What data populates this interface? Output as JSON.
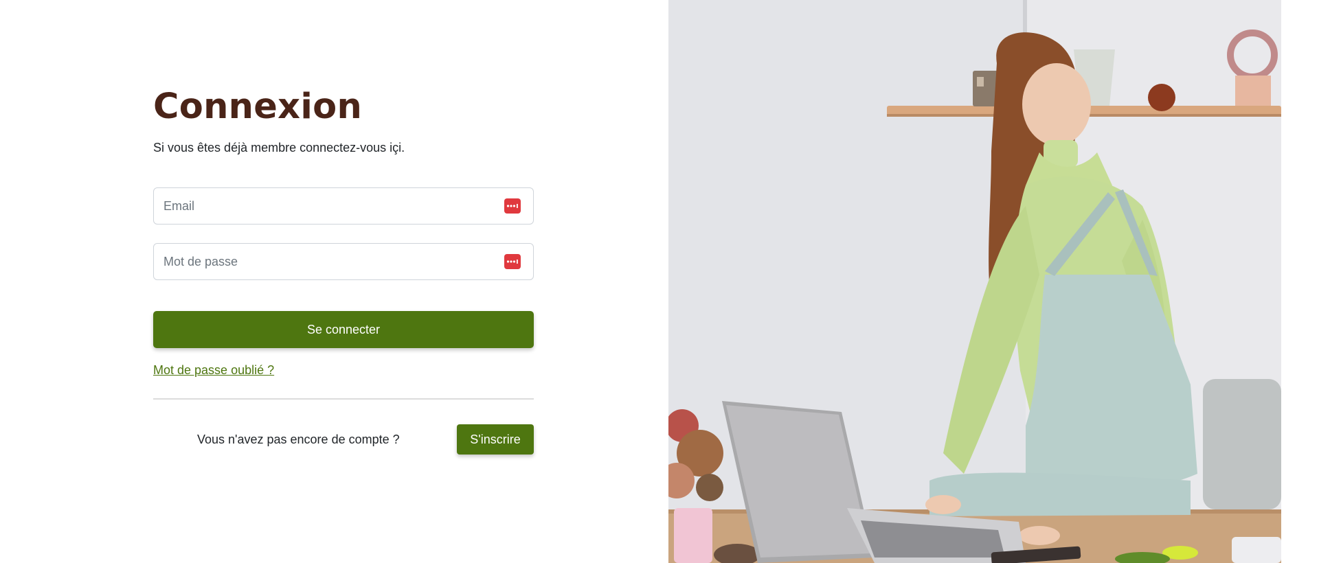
{
  "login": {
    "title": "Connexion",
    "subtitle": "Si vous êtes déjà membre connectez-vous içi.",
    "email_placeholder": "Email",
    "password_placeholder": "Mot de passe",
    "submit_label": "Se connecter",
    "forgot_label": "Mot de passe oublié ?"
  },
  "signup": {
    "prompt": "Vous n'avez pas encore de compte ?",
    "button_label": "S'inscrire"
  },
  "icons": {
    "field_icon": "password-manager-icon"
  },
  "colors": {
    "brand_green": "#4e7610",
    "title_brown": "#4a2418",
    "field_icon_red": "#e0393e"
  }
}
